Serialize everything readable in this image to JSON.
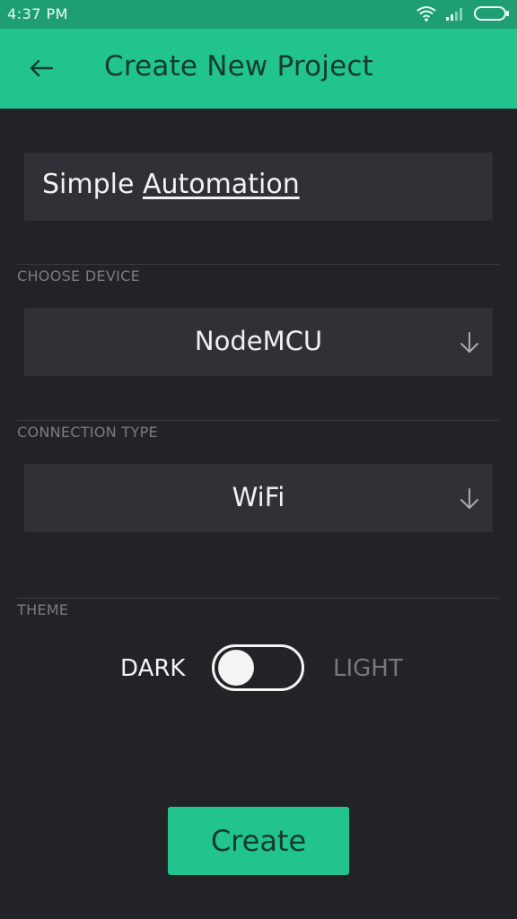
{
  "status_bar": {
    "time": "4:37 PM"
  },
  "app_bar": {
    "title": "Create New Project"
  },
  "project_name": {
    "word1": "Simple",
    "word2": "Automation"
  },
  "device": {
    "section_label": "CHOOSE DEVICE",
    "value": "NodeMCU"
  },
  "connection": {
    "section_label": "CONNECTION TYPE",
    "value": "WiFi"
  },
  "theme": {
    "section_label": "THEME",
    "dark_label": "DARK",
    "light_label": "LIGHT",
    "selected": "DARK"
  },
  "actions": {
    "create_label": "Create"
  },
  "colors": {
    "accent": "#22c48d",
    "status_bar": "#1f9e73",
    "background": "#222327",
    "field": "#303136"
  }
}
